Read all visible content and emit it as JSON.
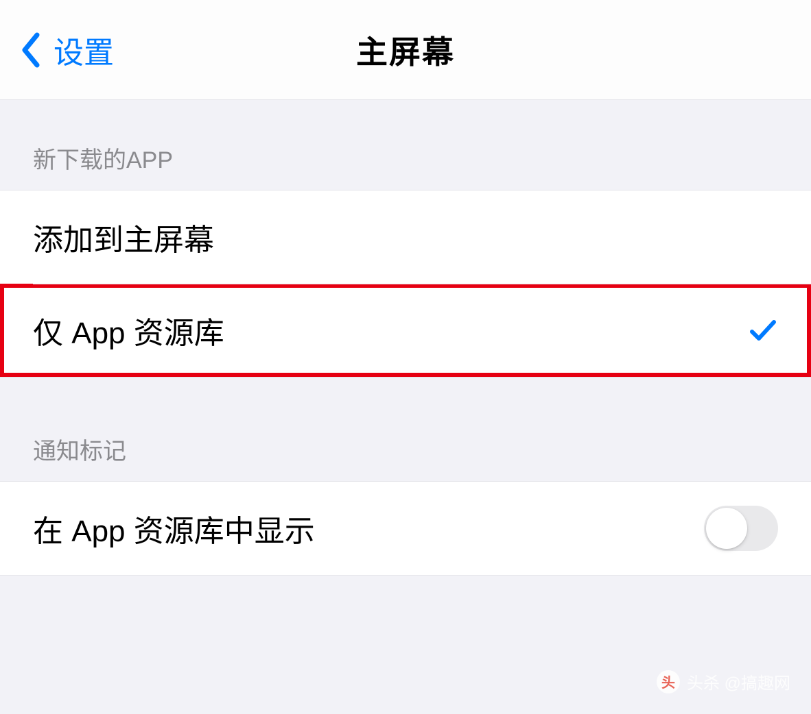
{
  "header": {
    "back_label": "设置",
    "title": "主屏幕"
  },
  "sections": {
    "new_downloads": {
      "header": "新下载的APP",
      "items": {
        "add_to_home": {
          "label": "添加到主屏幕",
          "selected": false
        },
        "app_library_only": {
          "label": "仅 App 资源库",
          "selected": true
        }
      }
    },
    "notification_badges": {
      "header": "通知标记",
      "items": {
        "show_in_app_library": {
          "label": "在 App 资源库中显示",
          "toggled": false
        }
      }
    }
  },
  "watermark": {
    "text": "头杀 @搞趣网"
  }
}
